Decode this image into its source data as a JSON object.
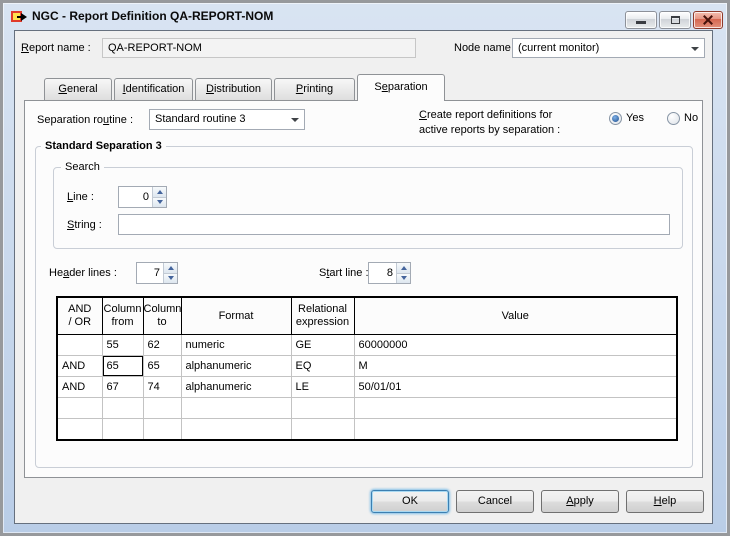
{
  "window": {
    "title": "NGC - Report Definition QA-REPORT-NOM"
  },
  "header": {
    "report_name": {
      "pre": "",
      "key": "R",
      "post": "eport name :",
      "value": "QA-REPORT-NOM"
    },
    "node_name": {
      "label": "Node name :",
      "value": "(current monitor)"
    }
  },
  "tabs": [
    {
      "pre": "",
      "key": "G",
      "post": "eneral"
    },
    {
      "pre": "",
      "key": "I",
      "post": "dentification"
    },
    {
      "pre": "",
      "key": "D",
      "post": "istribution"
    },
    {
      "pre": "",
      "key": "P",
      "post": "rinting"
    },
    {
      "pre": "S",
      "key": "e",
      "post": "paration"
    }
  ],
  "separation": {
    "routine_label": {
      "pre": "Separation ro",
      "key": "u",
      "post": "tine :"
    },
    "routine_value": "Standard routine 3",
    "create_label": {
      "line1_pre": "",
      "line1_key": "C",
      "line1_post": "reate report definitions for",
      "line2": "active reports by separation :"
    },
    "radio_yes": "Yes",
    "radio_no": "No",
    "radio_selected": "Yes",
    "group_title": "Standard Separation 3",
    "search": {
      "title": "Search",
      "line_label": {
        "pre": "",
        "key": "L",
        "post": "ine :"
      },
      "line_value": "0",
      "string_label": {
        "pre": "",
        "key": "S",
        "post": "tring :"
      },
      "string_value": ""
    },
    "header_lines_label": {
      "pre": "He",
      "key": "a",
      "post": "der lines :"
    },
    "header_lines_value": "7",
    "start_line_label": {
      "pre": "S",
      "key": "t",
      "post": "art line :"
    },
    "start_line_value": "8",
    "table": {
      "headers": [
        {
          "line1": "AND",
          "line2": "/ OR"
        },
        {
          "line1": "Column",
          "line2": "from"
        },
        {
          "line1": "Column",
          "line2": "to"
        },
        {
          "line1": "Format",
          "line2": ""
        },
        {
          "line1": "Relational",
          "line2": "expression"
        },
        {
          "line1": "Value",
          "line2": ""
        }
      ],
      "rows": [
        {
          "and_or": "",
          "col_from": "55",
          "col_to": "62",
          "format": "numeric",
          "rel": "GE",
          "value": "60000000"
        },
        {
          "and_or": "AND",
          "col_from": "65",
          "col_to": "65",
          "format": "alphanumeric",
          "rel": "EQ",
          "value": "M"
        },
        {
          "and_or": "AND",
          "col_from": "67",
          "col_to": "74",
          "format": "alphanumeric",
          "rel": "LE",
          "value": "50/01/01"
        },
        {
          "and_or": "",
          "col_from": "",
          "col_to": "",
          "format": "",
          "rel": "",
          "value": ""
        },
        {
          "and_or": "",
          "col_from": "",
          "col_to": "",
          "format": "",
          "rel": "",
          "value": ""
        }
      ]
    }
  },
  "buttons": {
    "ok": "OK",
    "cancel": "Cancel",
    "apply": {
      "pre": "",
      "key": "A",
      "post": "pply"
    },
    "help": {
      "pre": "",
      "key": "H",
      "post": "elp"
    }
  },
  "colors": {
    "titlebar_blue": "#cfdceb",
    "close_red": "#d5664f",
    "focus_blue": "#3c7fb1",
    "radio_dot_blue": "#2f67b1",
    "table_border": "#000000"
  }
}
